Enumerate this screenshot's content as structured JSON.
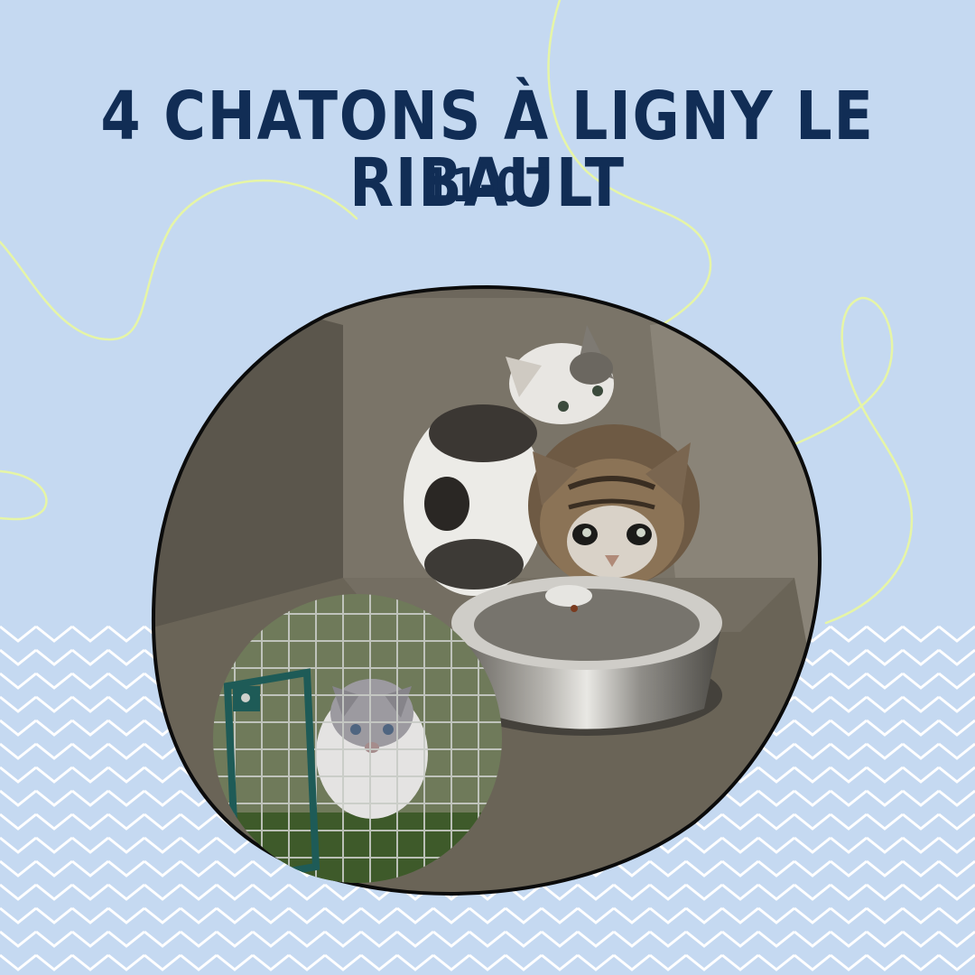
{
  "post": {
    "title": "4 CHATONS À LIGNY LE RIBAULT",
    "date": "11-07"
  },
  "colors": {
    "background": "#c5d9f1",
    "title": "#112d55",
    "squiggle": "#e6f5a6",
    "zigzag": "#ffffff",
    "blob_border": "#0b0b0b"
  },
  "images": {
    "main_photo": "kittens-in-carrier-photo",
    "inset_photo": "kitten-in-cage-photo"
  }
}
